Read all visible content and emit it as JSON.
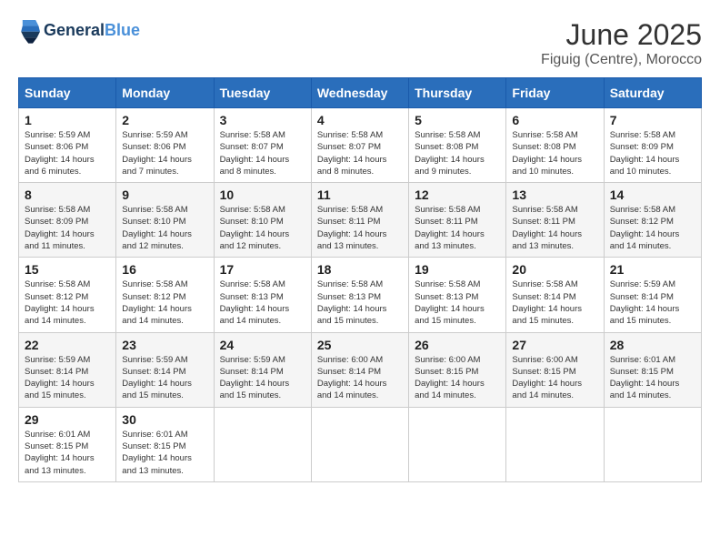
{
  "header": {
    "logo_line1": "General",
    "logo_line2": "Blue",
    "month_year": "June 2025",
    "location": "Figuig (Centre), Morocco"
  },
  "days_of_week": [
    "Sunday",
    "Monday",
    "Tuesday",
    "Wednesday",
    "Thursday",
    "Friday",
    "Saturday"
  ],
  "weeks": [
    [
      {
        "day": "1",
        "info": "Sunrise: 5:59 AM\nSunset: 8:06 PM\nDaylight: 14 hours\nand 6 minutes."
      },
      {
        "day": "2",
        "info": "Sunrise: 5:59 AM\nSunset: 8:06 PM\nDaylight: 14 hours\nand 7 minutes."
      },
      {
        "day": "3",
        "info": "Sunrise: 5:58 AM\nSunset: 8:07 PM\nDaylight: 14 hours\nand 8 minutes."
      },
      {
        "day": "4",
        "info": "Sunrise: 5:58 AM\nSunset: 8:07 PM\nDaylight: 14 hours\nand 8 minutes."
      },
      {
        "day": "5",
        "info": "Sunrise: 5:58 AM\nSunset: 8:08 PM\nDaylight: 14 hours\nand 9 minutes."
      },
      {
        "day": "6",
        "info": "Sunrise: 5:58 AM\nSunset: 8:08 PM\nDaylight: 14 hours\nand 10 minutes."
      },
      {
        "day": "7",
        "info": "Sunrise: 5:58 AM\nSunset: 8:09 PM\nDaylight: 14 hours\nand 10 minutes."
      }
    ],
    [
      {
        "day": "8",
        "info": "Sunrise: 5:58 AM\nSunset: 8:09 PM\nDaylight: 14 hours\nand 11 minutes."
      },
      {
        "day": "9",
        "info": "Sunrise: 5:58 AM\nSunset: 8:10 PM\nDaylight: 14 hours\nand 12 minutes."
      },
      {
        "day": "10",
        "info": "Sunrise: 5:58 AM\nSunset: 8:10 PM\nDaylight: 14 hours\nand 12 minutes."
      },
      {
        "day": "11",
        "info": "Sunrise: 5:58 AM\nSunset: 8:11 PM\nDaylight: 14 hours\nand 13 minutes."
      },
      {
        "day": "12",
        "info": "Sunrise: 5:58 AM\nSunset: 8:11 PM\nDaylight: 14 hours\nand 13 minutes."
      },
      {
        "day": "13",
        "info": "Sunrise: 5:58 AM\nSunset: 8:11 PM\nDaylight: 14 hours\nand 13 minutes."
      },
      {
        "day": "14",
        "info": "Sunrise: 5:58 AM\nSunset: 8:12 PM\nDaylight: 14 hours\nand 14 minutes."
      }
    ],
    [
      {
        "day": "15",
        "info": "Sunrise: 5:58 AM\nSunset: 8:12 PM\nDaylight: 14 hours\nand 14 minutes."
      },
      {
        "day": "16",
        "info": "Sunrise: 5:58 AM\nSunset: 8:12 PM\nDaylight: 14 hours\nand 14 minutes."
      },
      {
        "day": "17",
        "info": "Sunrise: 5:58 AM\nSunset: 8:13 PM\nDaylight: 14 hours\nand 14 minutes."
      },
      {
        "day": "18",
        "info": "Sunrise: 5:58 AM\nSunset: 8:13 PM\nDaylight: 14 hours\nand 15 minutes."
      },
      {
        "day": "19",
        "info": "Sunrise: 5:58 AM\nSunset: 8:13 PM\nDaylight: 14 hours\nand 15 minutes."
      },
      {
        "day": "20",
        "info": "Sunrise: 5:58 AM\nSunset: 8:14 PM\nDaylight: 14 hours\nand 15 minutes."
      },
      {
        "day": "21",
        "info": "Sunrise: 5:59 AM\nSunset: 8:14 PM\nDaylight: 14 hours\nand 15 minutes."
      }
    ],
    [
      {
        "day": "22",
        "info": "Sunrise: 5:59 AM\nSunset: 8:14 PM\nDaylight: 14 hours\nand 15 minutes."
      },
      {
        "day": "23",
        "info": "Sunrise: 5:59 AM\nSunset: 8:14 PM\nDaylight: 14 hours\nand 15 minutes."
      },
      {
        "day": "24",
        "info": "Sunrise: 5:59 AM\nSunset: 8:14 PM\nDaylight: 14 hours\nand 15 minutes."
      },
      {
        "day": "25",
        "info": "Sunrise: 6:00 AM\nSunset: 8:14 PM\nDaylight: 14 hours\nand 14 minutes."
      },
      {
        "day": "26",
        "info": "Sunrise: 6:00 AM\nSunset: 8:15 PM\nDaylight: 14 hours\nand 14 minutes."
      },
      {
        "day": "27",
        "info": "Sunrise: 6:00 AM\nSunset: 8:15 PM\nDaylight: 14 hours\nand 14 minutes."
      },
      {
        "day": "28",
        "info": "Sunrise: 6:01 AM\nSunset: 8:15 PM\nDaylight: 14 hours\nand 14 minutes."
      }
    ],
    [
      {
        "day": "29",
        "info": "Sunrise: 6:01 AM\nSunset: 8:15 PM\nDaylight: 14 hours\nand 13 minutes."
      },
      {
        "day": "30",
        "info": "Sunrise: 6:01 AM\nSunset: 8:15 PM\nDaylight: 14 hours\nand 13 minutes."
      },
      {
        "day": "",
        "info": ""
      },
      {
        "day": "",
        "info": ""
      },
      {
        "day": "",
        "info": ""
      },
      {
        "day": "",
        "info": ""
      },
      {
        "day": "",
        "info": ""
      }
    ]
  ]
}
